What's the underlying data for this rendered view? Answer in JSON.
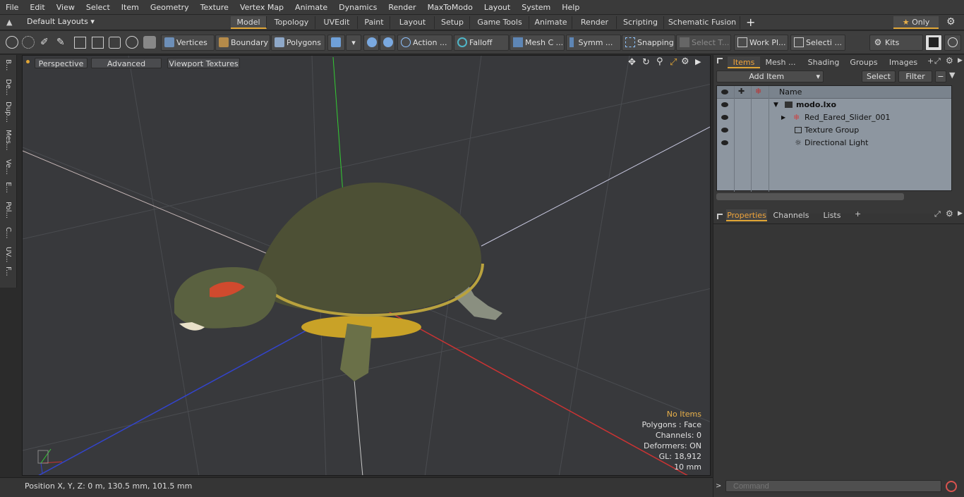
{
  "menu": [
    "File",
    "Edit",
    "View",
    "Select",
    "Item",
    "Geometry",
    "Texture",
    "Vertex Map",
    "Animate",
    "Dynamics",
    "Render",
    "MaxToModo",
    "Layout",
    "System",
    "Help"
  ],
  "layoutbar": {
    "default_layouts": "Default Layouts",
    "tabs": [
      "Model",
      "Topology",
      "UVEdit",
      "Paint",
      "Layout",
      "Setup",
      "Game Tools",
      "Animate",
      "Render",
      "Scripting",
      "Schematic Fusion"
    ],
    "active_tab": "Model",
    "add": "+",
    "only_label": "Only"
  },
  "toolbar": {
    "vertices": "Vertices",
    "boundary": "Boundary",
    "polygons": "Polygons",
    "action": "Action",
    "action_more": "...",
    "falloff": "Falloff",
    "mesh_c": "Mesh C ...",
    "symm": "Symm ...",
    "snapping": "Snapping",
    "select_t": "Select T...",
    "work_pl": "Work Pl...",
    "selecti": "Selecti ...",
    "kits": "Kits"
  },
  "left_tabs": [
    "B...",
    "De...",
    "Dup...",
    "Mes...",
    "Ve...",
    "E...",
    "Pol...",
    "C...",
    "UV...",
    "F..."
  ],
  "viewport": {
    "perspective": "Perspective",
    "advanced": "Advanced",
    "viewport_textures": "Viewport Textures",
    "info": {
      "no_items": "No Items",
      "polygons": "Polygons : Face",
      "channels": "Channels: 0",
      "deformers": "Deformers: ON",
      "gl": "GL: 18,912",
      "scale": "10 mm"
    }
  },
  "status": {
    "position": "Position X, Y, Z:   0 m, 130.5 mm, 101.5 mm"
  },
  "items_panel": {
    "tabs": [
      "Items",
      "Mesh ...",
      "Shading",
      "Groups",
      "Images"
    ],
    "active_tab": "Items",
    "add_item": "Add Item",
    "select": "Select",
    "filter": "Filter",
    "name_header": "Name",
    "tree": [
      {
        "label": "modo.lxo",
        "depth": 0,
        "bold": true
      },
      {
        "label": "Red_Eared_Slider_001",
        "depth": 1,
        "bold": false
      },
      {
        "label": "Texture Group",
        "depth": 1,
        "bold": false
      },
      {
        "label": "Directional Light",
        "depth": 1,
        "bold": false
      }
    ]
  },
  "properties_panel": {
    "tabs": [
      "Properties",
      "Channels",
      "Lists"
    ],
    "active_tab": "Properties",
    "add": "+"
  },
  "command": {
    "placeholder": "Command"
  },
  "colors": {
    "accent": "#e1a636",
    "axis_x": "#cc3333",
    "axis_y": "#33cc33",
    "axis_z": "#3344cc"
  }
}
